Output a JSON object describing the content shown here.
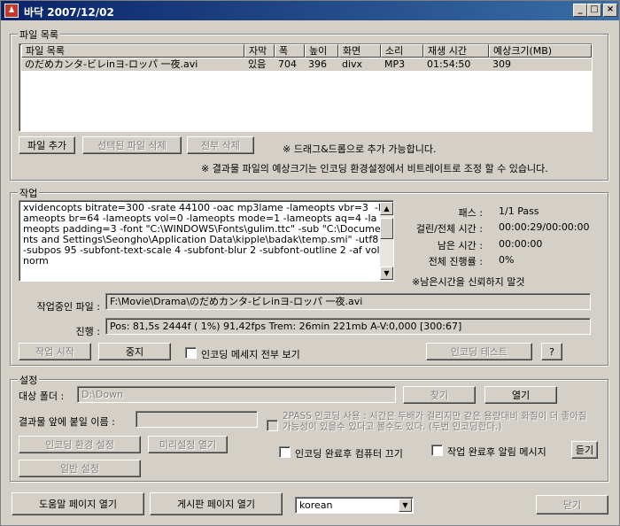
{
  "window": {
    "title": "바닥 2007/12/02",
    "app_icon": "app-icon",
    "controls": {
      "minimize": "_",
      "maximize": "□",
      "close": "×"
    }
  },
  "file_list": {
    "legend": "파일 목록",
    "columns": [
      "파일 목록",
      "자막",
      "폭",
      "높이",
      "화면",
      "소리",
      "재생 시간",
      "예상크기(MB)"
    ],
    "rows": [
      [
        "のだめカンタ-ビレinヨ-ロッパ 一夜.avi",
        "있음",
        "704",
        "396",
        "divx",
        "MP3",
        "01:54:50",
        "309"
      ]
    ],
    "add_button": "파일 추가",
    "delete_selected_button": "선택된 파일 삭제",
    "delete_all_button": "전부 삭제",
    "drag_hint": "※ 드래그&드롭으로 추가 가능합니다.",
    "size_hint": "※ 결과물 파일의 예상크기는 인코딩 환경설정에서 비트레이트로 조정 할 수 있습니다."
  },
  "job": {
    "legend": "작업",
    "log": "xvidencopts bitrate=300 -srate 44100 -oac mp3lame -lameopts vbr=3  -lameopts br=64 -lameopts vol=0 -lameopts mode=1 -lameopts aq=4 -lameopts padding=3 -font \"C:\\WINDOWS\\Fonts\\gulim.ttc\" -sub \"C:\\Documents and Settings\\Seongho\\Application Data\\kipple\\badak\\temp.smi\" -utf8  -subpos 95 -subfont-text-scale 4 -subfont-blur 2 -subfont-outline 2 -af volnorm",
    "pass_label": "패스 :",
    "pass_value": "1/1 Pass",
    "elapsed_label": "걸린/전체 시간 :",
    "elapsed_value": "00:00:29/00:00:00",
    "remaining_label": "남은 시간 :",
    "remaining_value": "00:00:00",
    "progress_label": "전체 진행률 :",
    "progress_value": "0%",
    "remaining_note": "※남은시간을 신뢰하지 말것",
    "current_file_label": "작업중인 파일 :",
    "current_file_value": "F:\\Movie\\Drama\\のだめカンタ-ビレinヨ-ロッパ 一夜.avi",
    "status_label": "진행 :",
    "status_value": "Pos:  81,5s   2444f ( 1%) 91,42fps Trem:  26min 221mb  A-V:0,000 [300:67]",
    "start_button": "작업 시작",
    "stop_button": "중지",
    "show_all_messages_label": "인코딩 메세지 전부 보기",
    "test_button": "인코딩 테스트",
    "help_button": "?"
  },
  "settings": {
    "legend": "설정",
    "target_folder_label": "대상 폴더 :",
    "target_folder_value": "D:\\Down",
    "find_button": "찾기",
    "open_button": "열기",
    "prefix_label": "결과물 앞에 붙일 이름 :",
    "prefix_value": "",
    "twopass_label": "2PASS 인코딩 사용 : 시간은 두배가 걸리지만 같은 용량대비 화질이 더 좋아질 가능성이 있을수 있다고 볼수도 있다. (두번 인코딩한다.)",
    "encoding_settings_button": "인코딩 환경 설정",
    "preset_button": "미리설정 열기",
    "general_settings_button": "일반 설정",
    "shutdown_label": "인코딩 완료후 컴퓨터 끄기",
    "notify_label": "작업 완료후 알림 메시지",
    "listen_button": "듣기"
  },
  "footer": {
    "help_page_button": "도움말 페이지 열기",
    "board_page_button": "게시판 페이지 열기",
    "language_value": "korean",
    "close_button": "닫기"
  }
}
